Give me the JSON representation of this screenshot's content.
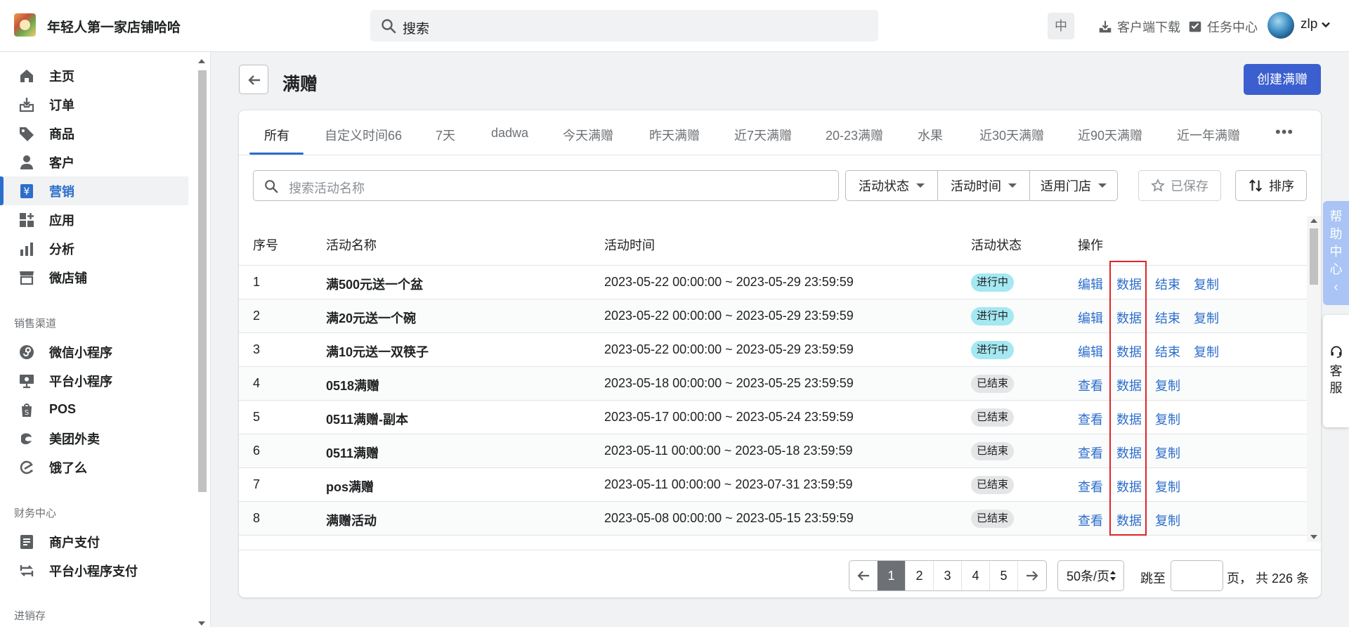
{
  "header": {
    "store_name": "年轻人第一家店铺哈哈",
    "search_placeholder": "搜索",
    "lang": "中",
    "download": "客户端下载",
    "tasks": "任务中心",
    "username": "zlp"
  },
  "sidebar": {
    "items": [
      {
        "label": "主页",
        "icon": "home-icon"
      },
      {
        "label": "订单",
        "icon": "orders-icon"
      },
      {
        "label": "商品",
        "icon": "tag-icon"
      },
      {
        "label": "客户",
        "icon": "person-icon"
      },
      {
        "label": "营销",
        "icon": "marketing-icon"
      },
      {
        "label": "应用",
        "icon": "apps-icon"
      },
      {
        "label": "分析",
        "icon": "analytics-icon"
      },
      {
        "label": "微店铺",
        "icon": "store-icon"
      }
    ],
    "sales_channels_title": "销售渠道",
    "channels": [
      {
        "label": "微信小程序",
        "icon": "wechat-miniprogram-icon"
      },
      {
        "label": "平台小程序",
        "icon": "platform-miniprogram-icon"
      },
      {
        "label": "POS",
        "icon": "pos-icon"
      },
      {
        "label": "美团外卖",
        "icon": "meituan-icon"
      },
      {
        "label": "饿了么",
        "icon": "eleme-icon"
      }
    ],
    "finance_title": "财务中心",
    "finance": [
      {
        "label": "商户支付",
        "icon": "merchant-pay-icon"
      },
      {
        "label": "平台小程序支付",
        "icon": "platform-pay-icon"
      }
    ],
    "inventory_title": "进销存"
  },
  "page": {
    "title": "满赠",
    "create_label": "创建满赠"
  },
  "tabs": [
    "所有",
    "自定义时间66",
    "7天",
    "dadwa",
    "今天满赠",
    "昨天满赠",
    "近7天满赠",
    "20-23满赠",
    "水果",
    "近30天满赠",
    "近90天满赠",
    "近一年满赠"
  ],
  "filters": {
    "search_placeholder": "搜索活动名称",
    "status": "活动状态",
    "time": "活动时间",
    "store": "适用门店",
    "saved": "已保存",
    "sort": "排序"
  },
  "table": {
    "headers": [
      "序号",
      "活动名称",
      "活动时间",
      "活动状态",
      "操作"
    ],
    "rows": [
      {
        "no": "1",
        "name": "满500元送一个盆",
        "time": "2023-05-22 00:00:00 ~ 2023-05-29 23:59:59",
        "status": "进行中",
        "a1": "编辑",
        "a2": "数据",
        "a3": "结束",
        "a4": "复制"
      },
      {
        "no": "2",
        "name": "满20元送一个碗",
        "time": "2023-05-22 00:00:00 ~ 2023-05-29 23:59:59",
        "status": "进行中",
        "a1": "编辑",
        "a2": "数据",
        "a3": "结束",
        "a4": "复制"
      },
      {
        "no": "3",
        "name": "满10元送一双筷子",
        "time": "2023-05-22 00:00:00 ~ 2023-05-29 23:59:59",
        "status": "进行中",
        "a1": "编辑",
        "a2": "数据",
        "a3": "结束",
        "a4": "复制"
      },
      {
        "no": "4",
        "name": "0518满赠",
        "time": "2023-05-18 00:00:00 ~ 2023-05-25 23:59:59",
        "status": "已结束",
        "a1": "查看",
        "a2": "数据",
        "a3": "复制",
        "a4": ""
      },
      {
        "no": "5",
        "name": "0511满赠-副本",
        "time": "2023-05-17 00:00:00 ~ 2023-05-24 23:59:59",
        "status": "已结束",
        "a1": "查看",
        "a2": "数据",
        "a3": "复制",
        "a4": ""
      },
      {
        "no": "6",
        "name": "0511满赠",
        "time": "2023-05-11 00:00:00 ~ 2023-05-18 23:59:59",
        "status": "已结束",
        "a1": "查看",
        "a2": "数据",
        "a3": "复制",
        "a4": ""
      },
      {
        "no": "7",
        "name": "pos满赠",
        "time": "2023-05-11 00:00:00 ~ 2023-07-31 23:59:59",
        "status": "已结束",
        "a1": "查看",
        "a2": "数据",
        "a3": "复制",
        "a4": ""
      },
      {
        "no": "8",
        "name": "满赠活动",
        "time": "2023-05-08 00:00:00 ~ 2023-05-15 23:59:59",
        "status": "已结束",
        "a1": "查看",
        "a2": "数据",
        "a3": "复制",
        "a4": ""
      }
    ]
  },
  "pagination": {
    "pages": [
      "1",
      "2",
      "3",
      "4",
      "5"
    ],
    "page_size": "50条/页",
    "jump_label": "跳至",
    "total_label": "页， 共 226 条"
  },
  "floating": {
    "help": "帮助中心",
    "help_arrow": "‹",
    "service": "客服"
  },
  "colors": {
    "accent": "#2c6ecb",
    "primary_button": "#3b5fce",
    "running_badge": "#a4e8f2",
    "ended_badge": "#e4e5e7",
    "highlight_box": "#e02424"
  }
}
